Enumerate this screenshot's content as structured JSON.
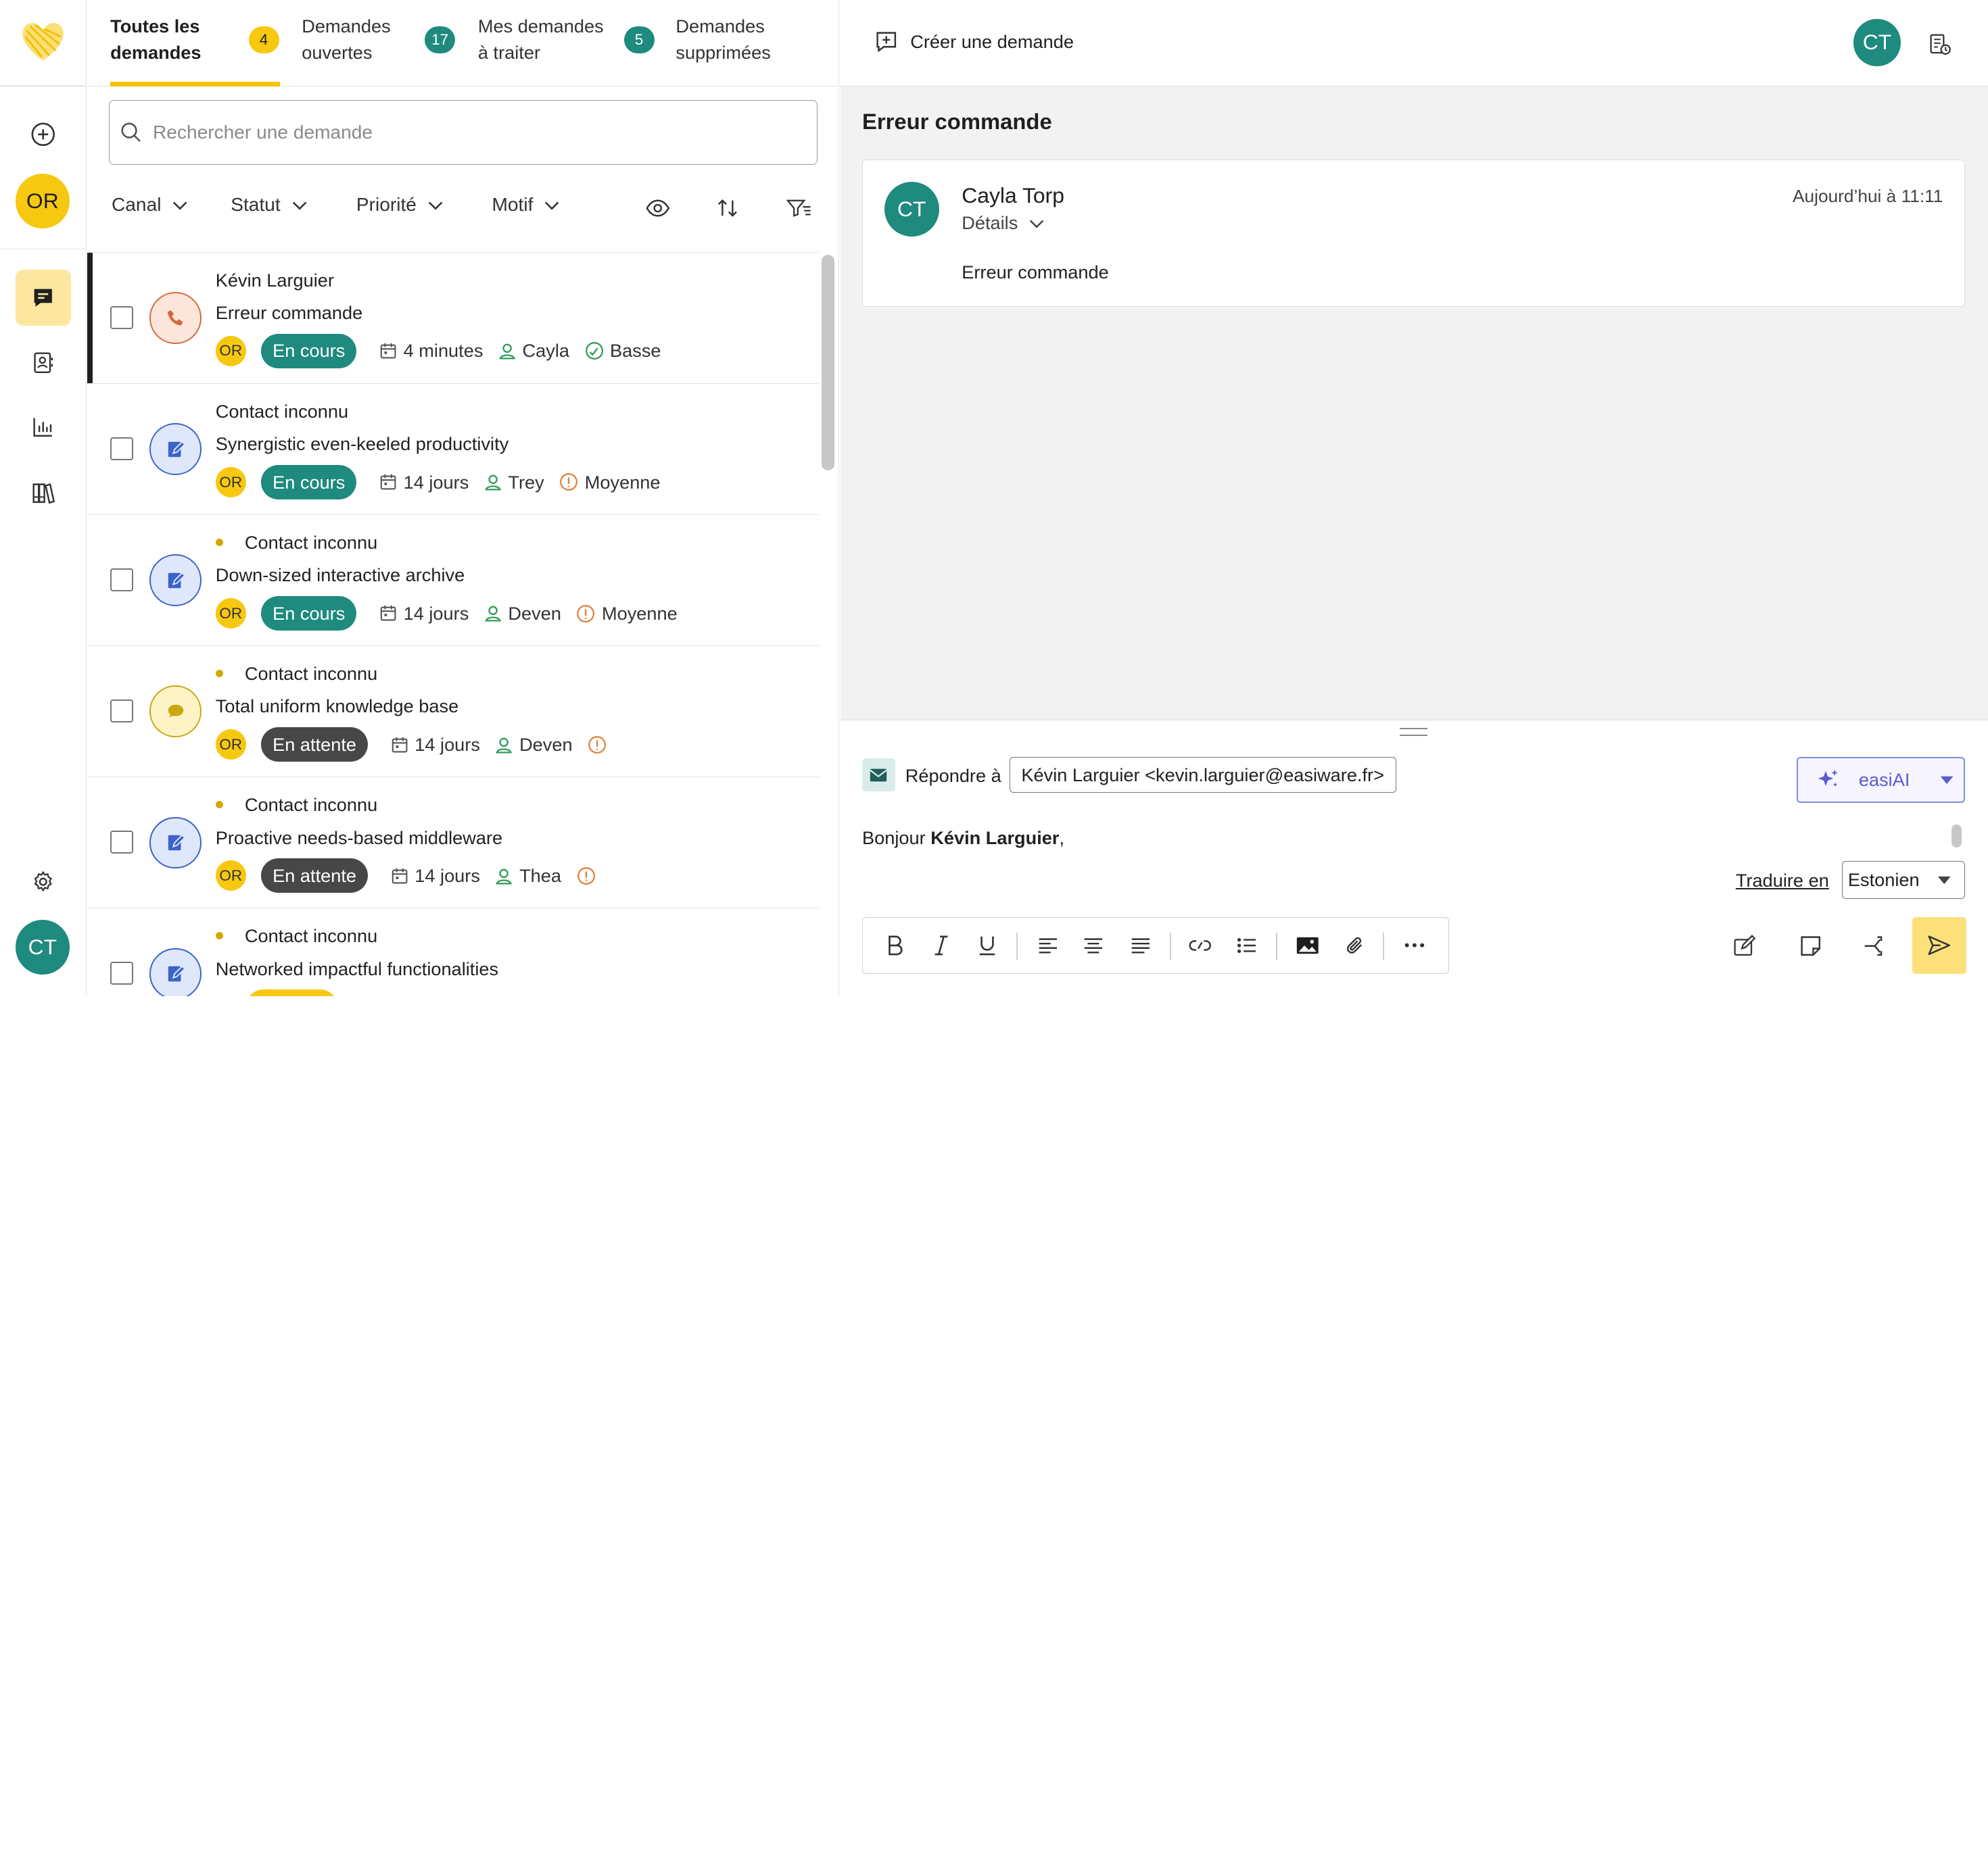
{
  "rail": {
    "user_initials": "OR",
    "bottom_initials": "CT"
  },
  "tabs": [
    {
      "label_line1": "Toutes les",
      "label_line2": "demandes",
      "badge": "4"
    },
    {
      "label_line1": "Demandes",
      "label_line2": "ouvertes",
      "badge": "17"
    },
    {
      "label_line1": "Mes demandes",
      "label_line2": "à traiter",
      "badge": "5"
    },
    {
      "label_line1": "Demandes",
      "label_line2": "supprimées"
    }
  ],
  "search": {
    "placeholder": "Rechercher une demande"
  },
  "filters": {
    "canal": "Canal",
    "statut": "Statut",
    "priorite": "Priorité",
    "motif": "Motif"
  },
  "requests": [
    {
      "contact": "Kévin Larguier",
      "subject": "Erreur commande",
      "channel": "phone-icon",
      "initials": "OR",
      "status": "En cours",
      "age": "4 minutes",
      "agent": "Cayla",
      "priority": "Basse",
      "unread": false
    },
    {
      "contact": "Contact inconnu",
      "subject": "Synergistic even-keeled productivity",
      "channel": "form-icon",
      "initials": "OR",
      "status": "En cours",
      "age": "14 jours",
      "agent": "Trey",
      "priority": "Moyenne",
      "unread": false
    },
    {
      "contact": "Contact inconnu",
      "subject": "Down-sized interactive archive",
      "channel": "form-icon",
      "initials": "OR",
      "status": "En cours",
      "age": "14 jours",
      "agent": "Deven",
      "priority": "Moyenne",
      "unread": true
    },
    {
      "contact": "Contact inconnu",
      "subject": "Total uniform knowledge base",
      "channel": "chat-icon",
      "initials": "OR",
      "status": "En attente",
      "age": "14 jours",
      "agent": "Deven",
      "priority": "",
      "unread": true
    },
    {
      "contact": "Contact inconnu",
      "subject": "Proactive needs-based middleware",
      "channel": "form-icon",
      "initials": "OR",
      "status": "En attente",
      "age": "14 jours",
      "agent": "Thea",
      "priority": "",
      "unread": true
    },
    {
      "contact": "Contact inconnu",
      "subject": "Networked impactful functionalities",
      "channel": "form-icon",
      "initials": "",
      "status": "",
      "age": "",
      "agent": "",
      "priority": "",
      "unread": true
    }
  ],
  "header": {
    "create_label": "Créer une demande",
    "user_initials": "CT"
  },
  "detail": {
    "title": "Erreur commande",
    "message": {
      "initials": "CT",
      "author": "Cayla Torp",
      "details_label": "Détails",
      "time": "Aujourd’hui à 11:11",
      "body": "Erreur commande"
    }
  },
  "reply": {
    "label": "Répondre à",
    "to": "Kévin Larguier <kevin.larguier@easiware.fr>",
    "ai_label": "easiAI",
    "greeting_prefix": "Bonjour ",
    "greeting_name": "Kévin Larguier",
    "greeting_suffix": ",",
    "translate_label": "Traduire en",
    "language": "Estonien"
  },
  "colors": {
    "brand_yellow": "#f7c810",
    "teal": "#1f8a7e",
    "status_waiting": "#474747",
    "send_bg": "#fde07a"
  }
}
